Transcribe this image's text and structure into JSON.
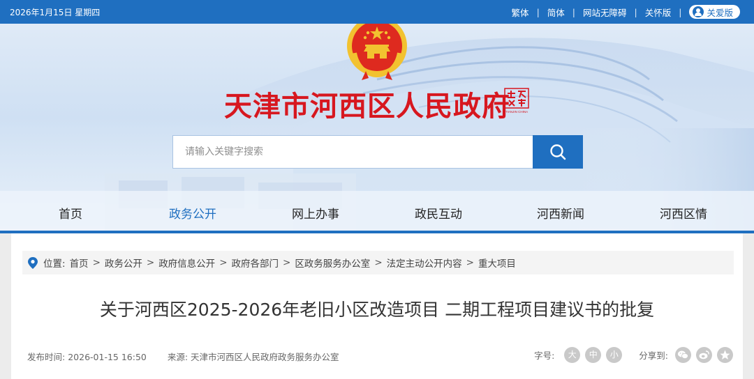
{
  "topbar": {
    "date": "2026年1月15日 星期四",
    "links": [
      "繁体",
      "简体",
      "网站无障碍",
      "关怀版"
    ],
    "care_button": "关爱版"
  },
  "header": {
    "site_title": "天津市河西区人民政府",
    "logo_text": [
      "天津",
      "TIANJIN CHINA"
    ]
  },
  "search": {
    "placeholder": "请输入关键字搜索",
    "button_icon": "search-icon"
  },
  "nav": {
    "items": [
      "首页",
      "政务公开",
      "网上办事",
      "政民互动",
      "河西新闻",
      "河西区情"
    ],
    "active": "政务公开"
  },
  "breadcrumb": {
    "label": "位置:",
    "items": [
      "首页",
      "政务公开",
      "政府信息公开",
      "政府各部门",
      "区政务服务办公室",
      "法定主动公开内容",
      "重大项目"
    ]
  },
  "article": {
    "title": "关于河西区2025-2026年老旧小区改造项目 二期工程项目建议书的批复",
    "publish_label": "发布时间:",
    "publish_time": "2026-01-15 16:50",
    "source_label": "来源:",
    "source": "天津市河西区人民政府政务服务办公室"
  },
  "tools": {
    "font_label": "字号:",
    "font_sizes": [
      "大",
      "中",
      "小"
    ],
    "share_label": "分享到:",
    "share_icons": [
      "wechat-icon",
      "weibo-icon",
      "qzone-icon"
    ]
  },
  "colors": {
    "primary": "#1f6fc0",
    "title_red": "#d7171f",
    "emblem_gold": "#f2c230",
    "emblem_red": "#de2a1f"
  }
}
